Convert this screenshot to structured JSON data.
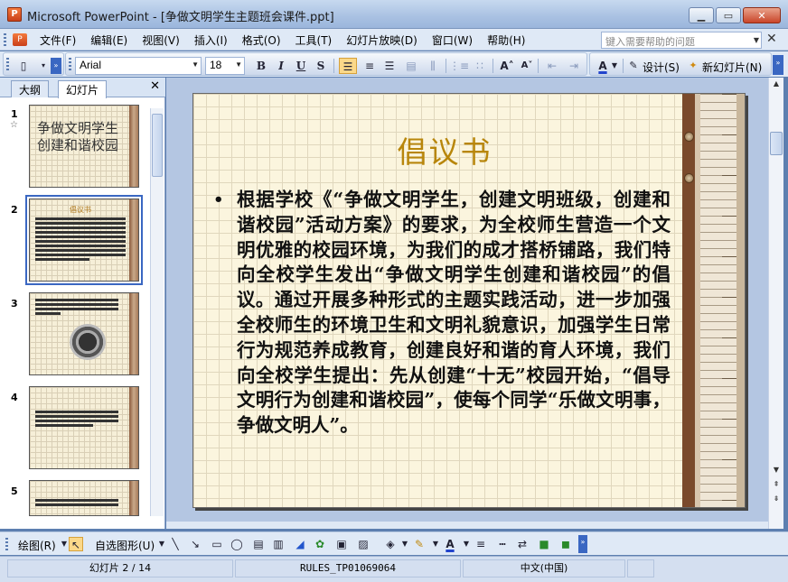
{
  "window": {
    "title": "Microsoft PowerPoint - [争做文明学生主题班会课件.ppt]",
    "app_icon_letter": "P"
  },
  "menu": {
    "items": [
      "文件(F)",
      "编辑(E)",
      "视图(V)",
      "插入(I)",
      "格式(O)",
      "工具(T)",
      "幻灯片放映(D)",
      "窗口(W)",
      "帮助(H)"
    ],
    "help_placeholder": "键入需要帮助的问题"
  },
  "toolbar": {
    "font_name": "Arial",
    "font_size": "18",
    "bold": "B",
    "italic": "I",
    "underline": "U",
    "shadow": "S",
    "design_label": "设计(S)",
    "new_slide_label": "新幻灯片(N)"
  },
  "left_pane": {
    "tabs": [
      "大纲",
      "幻灯片"
    ],
    "active_tab": "幻灯片",
    "thumbnails": [
      {
        "number": "1",
        "title_line1": "争做文明学生",
        "title_line2": "创建和谐校园"
      },
      {
        "number": "2",
        "mini_title": "倡议书"
      },
      {
        "number": "3"
      },
      {
        "number": "4"
      },
      {
        "number": "5"
      }
    ]
  },
  "slide": {
    "title": "倡议书",
    "body": "根据学校《“争做文明学生，创建文明班级，创建和谐校园”活动方案》的要求，为全校师生营造一个文明优雅的校园环境，为我们的成才搭桥铺路，我们特向全校学生发出“争做文明学生创建和谐校园”的倡议。通过开展多种形式的主题实践活动，进一步加强全校师生的环境卫生和文明礼貌意识，加强学生日常行为规范养成教育，创建良好和谐的育人环境，我们向全校学生提出：先从创建“十无”校园开始，“倡导文明行为创建和谐校园”，使每个同学“乐做文明事，争做文明人”。",
    "title_color": "#b8860b"
  },
  "drawing_toolbar": {
    "draw_label": "绘图(R)",
    "autoshape_label": "自选图形(U)"
  },
  "status": {
    "slide_position": "幻灯片 2 / 14",
    "design_template": "RULES_TP01069064",
    "language": "中文(中国)"
  }
}
